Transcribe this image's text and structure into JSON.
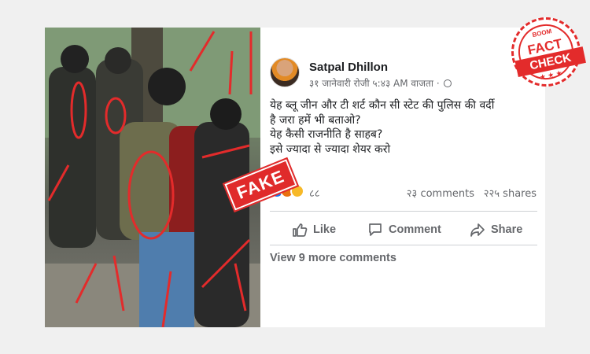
{
  "post": {
    "author": "Satpal Dhillon",
    "meta": "३१ जानेवारी रोजी ५:४३ AM वाजता ·",
    "text_lines": [
      "येह ब्लू जीन और टी शर्ट कौन सी स्टेट की पुलिस की वर्दी",
      "है जरा हमें भी बताओ?",
      "येह कैसी राजनीति है साहब?",
      "इसे ज्यादा से ज्यादा शेयर करो"
    ],
    "reaction_count": "८८",
    "comments_count": "२३ comments",
    "shares_count": "२२५ shares",
    "actions": {
      "like": "Like",
      "comment": "Comment",
      "share": "Share"
    },
    "view_more": "View 9 more comments",
    "icons": [
      "globe-icon",
      "like-reaction-icon",
      "angry-reaction-icon",
      "sad-reaction-icon",
      "thumbs-up-icon",
      "comment-icon",
      "share-icon"
    ]
  },
  "overlays": {
    "fake_label": "FAKE",
    "badge_small": "BOOM",
    "badge_top": "FACT",
    "badge_bottom": "CHECK",
    "badge_stars": "★ ★ ★",
    "accent": "#e32b2b"
  }
}
